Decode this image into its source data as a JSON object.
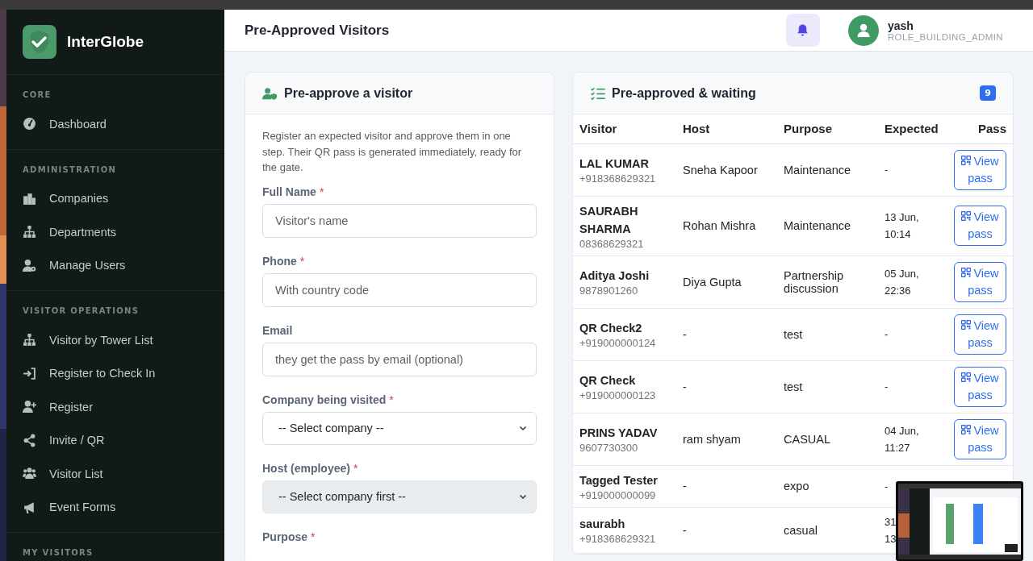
{
  "brand": {
    "name": "InterGlobe"
  },
  "sidebar": {
    "sections": [
      {
        "heading": "CORE",
        "items": [
          {
            "label": "Dashboard"
          }
        ]
      },
      {
        "heading": "ADMINISTRATION",
        "items": [
          {
            "label": "Companies"
          },
          {
            "label": "Departments"
          },
          {
            "label": "Manage Users"
          }
        ]
      },
      {
        "heading": "VISITOR OPERATIONS",
        "items": [
          {
            "label": "Visitor by Tower List"
          },
          {
            "label": "Register to Check In"
          },
          {
            "label": "Register"
          },
          {
            "label": "Invite / QR"
          },
          {
            "label": "Visitor List"
          },
          {
            "label": "Event Forms"
          }
        ]
      },
      {
        "heading": "MY VISITORS"
      }
    ]
  },
  "header": {
    "title": "Pre-Approved Visitors",
    "user": {
      "name": "yash",
      "role": "ROLE_BUILDING_ADMIN"
    }
  },
  "form_card": {
    "title": "Pre-approve a visitor",
    "intro": "Register an expected visitor and approve them in one step. Their QR pass is generated immediately, ready for the gate.",
    "fields": [
      {
        "kind": "input",
        "label": "Full Name",
        "required_mark": "*",
        "placeholder": "Visitor's name"
      },
      {
        "kind": "input",
        "label": "Phone",
        "required_mark": "*",
        "placeholder": "With country code"
      },
      {
        "kind": "input",
        "label": "Email",
        "placeholder": "they get the pass by email (optional)"
      },
      {
        "kind": "select",
        "label": "Company being visited",
        "required_mark": "*",
        "value": "-- Select company --",
        "disabled": false
      },
      {
        "kind": "select",
        "label": "Host (employee)",
        "required_mark": "*",
        "value": "-- Select company first --",
        "disabled": true
      },
      {
        "kind": "label",
        "label": "Purpose",
        "required_mark": "*"
      }
    ]
  },
  "list_card": {
    "title": "Pre-approved & waiting",
    "count": "9",
    "columns": [
      "Visitor",
      "Host",
      "Purpose",
      "Expected",
      "Pass"
    ],
    "rows": [
      {
        "name": "LAL KUMAR",
        "phone": "+918368629321",
        "host": "Sneha Kapoor",
        "purpose": "Maintenance",
        "expected": [
          "-"
        ],
        "pass": "View pass"
      },
      {
        "name": "SAURABH SHARMA",
        "phone": "08368629321",
        "host": "Rohan Mishra",
        "purpose": "Maintenance",
        "expected": [
          "13 Jun,",
          "10:14"
        ],
        "pass": "View pass"
      },
      {
        "name": "Aditya Joshi",
        "phone": "9878901260",
        "host": "Diya Gupta",
        "purpose": "Partnership discussion",
        "expected": [
          "05 Jun,",
          "22:36"
        ],
        "pass": "View pass"
      },
      {
        "name": "QR Check2",
        "phone": "+919000000124",
        "host": "-",
        "purpose": "test",
        "expected": [
          "-"
        ],
        "pass": "View pass"
      },
      {
        "name": "QR Check",
        "phone": "+919000000123",
        "host": "-",
        "purpose": "test",
        "expected": [
          "-"
        ],
        "pass": "View pass"
      },
      {
        "name": "PRINS YADAV",
        "phone": "9607730300",
        "host": "ram shyam",
        "purpose": "CASUAL",
        "expected": [
          "04 Jun,",
          "11:27"
        ],
        "pass": "View pass"
      },
      {
        "name": "Tagged Tester",
        "phone": "+919000000099",
        "host": "-",
        "purpose": "expo",
        "expected": [
          "-"
        ]
      },
      {
        "name": "saurabh",
        "phone": "+918368629321",
        "host": "-",
        "purpose": "casual",
        "expected": [
          "31",
          "13"
        ]
      }
    ]
  }
}
